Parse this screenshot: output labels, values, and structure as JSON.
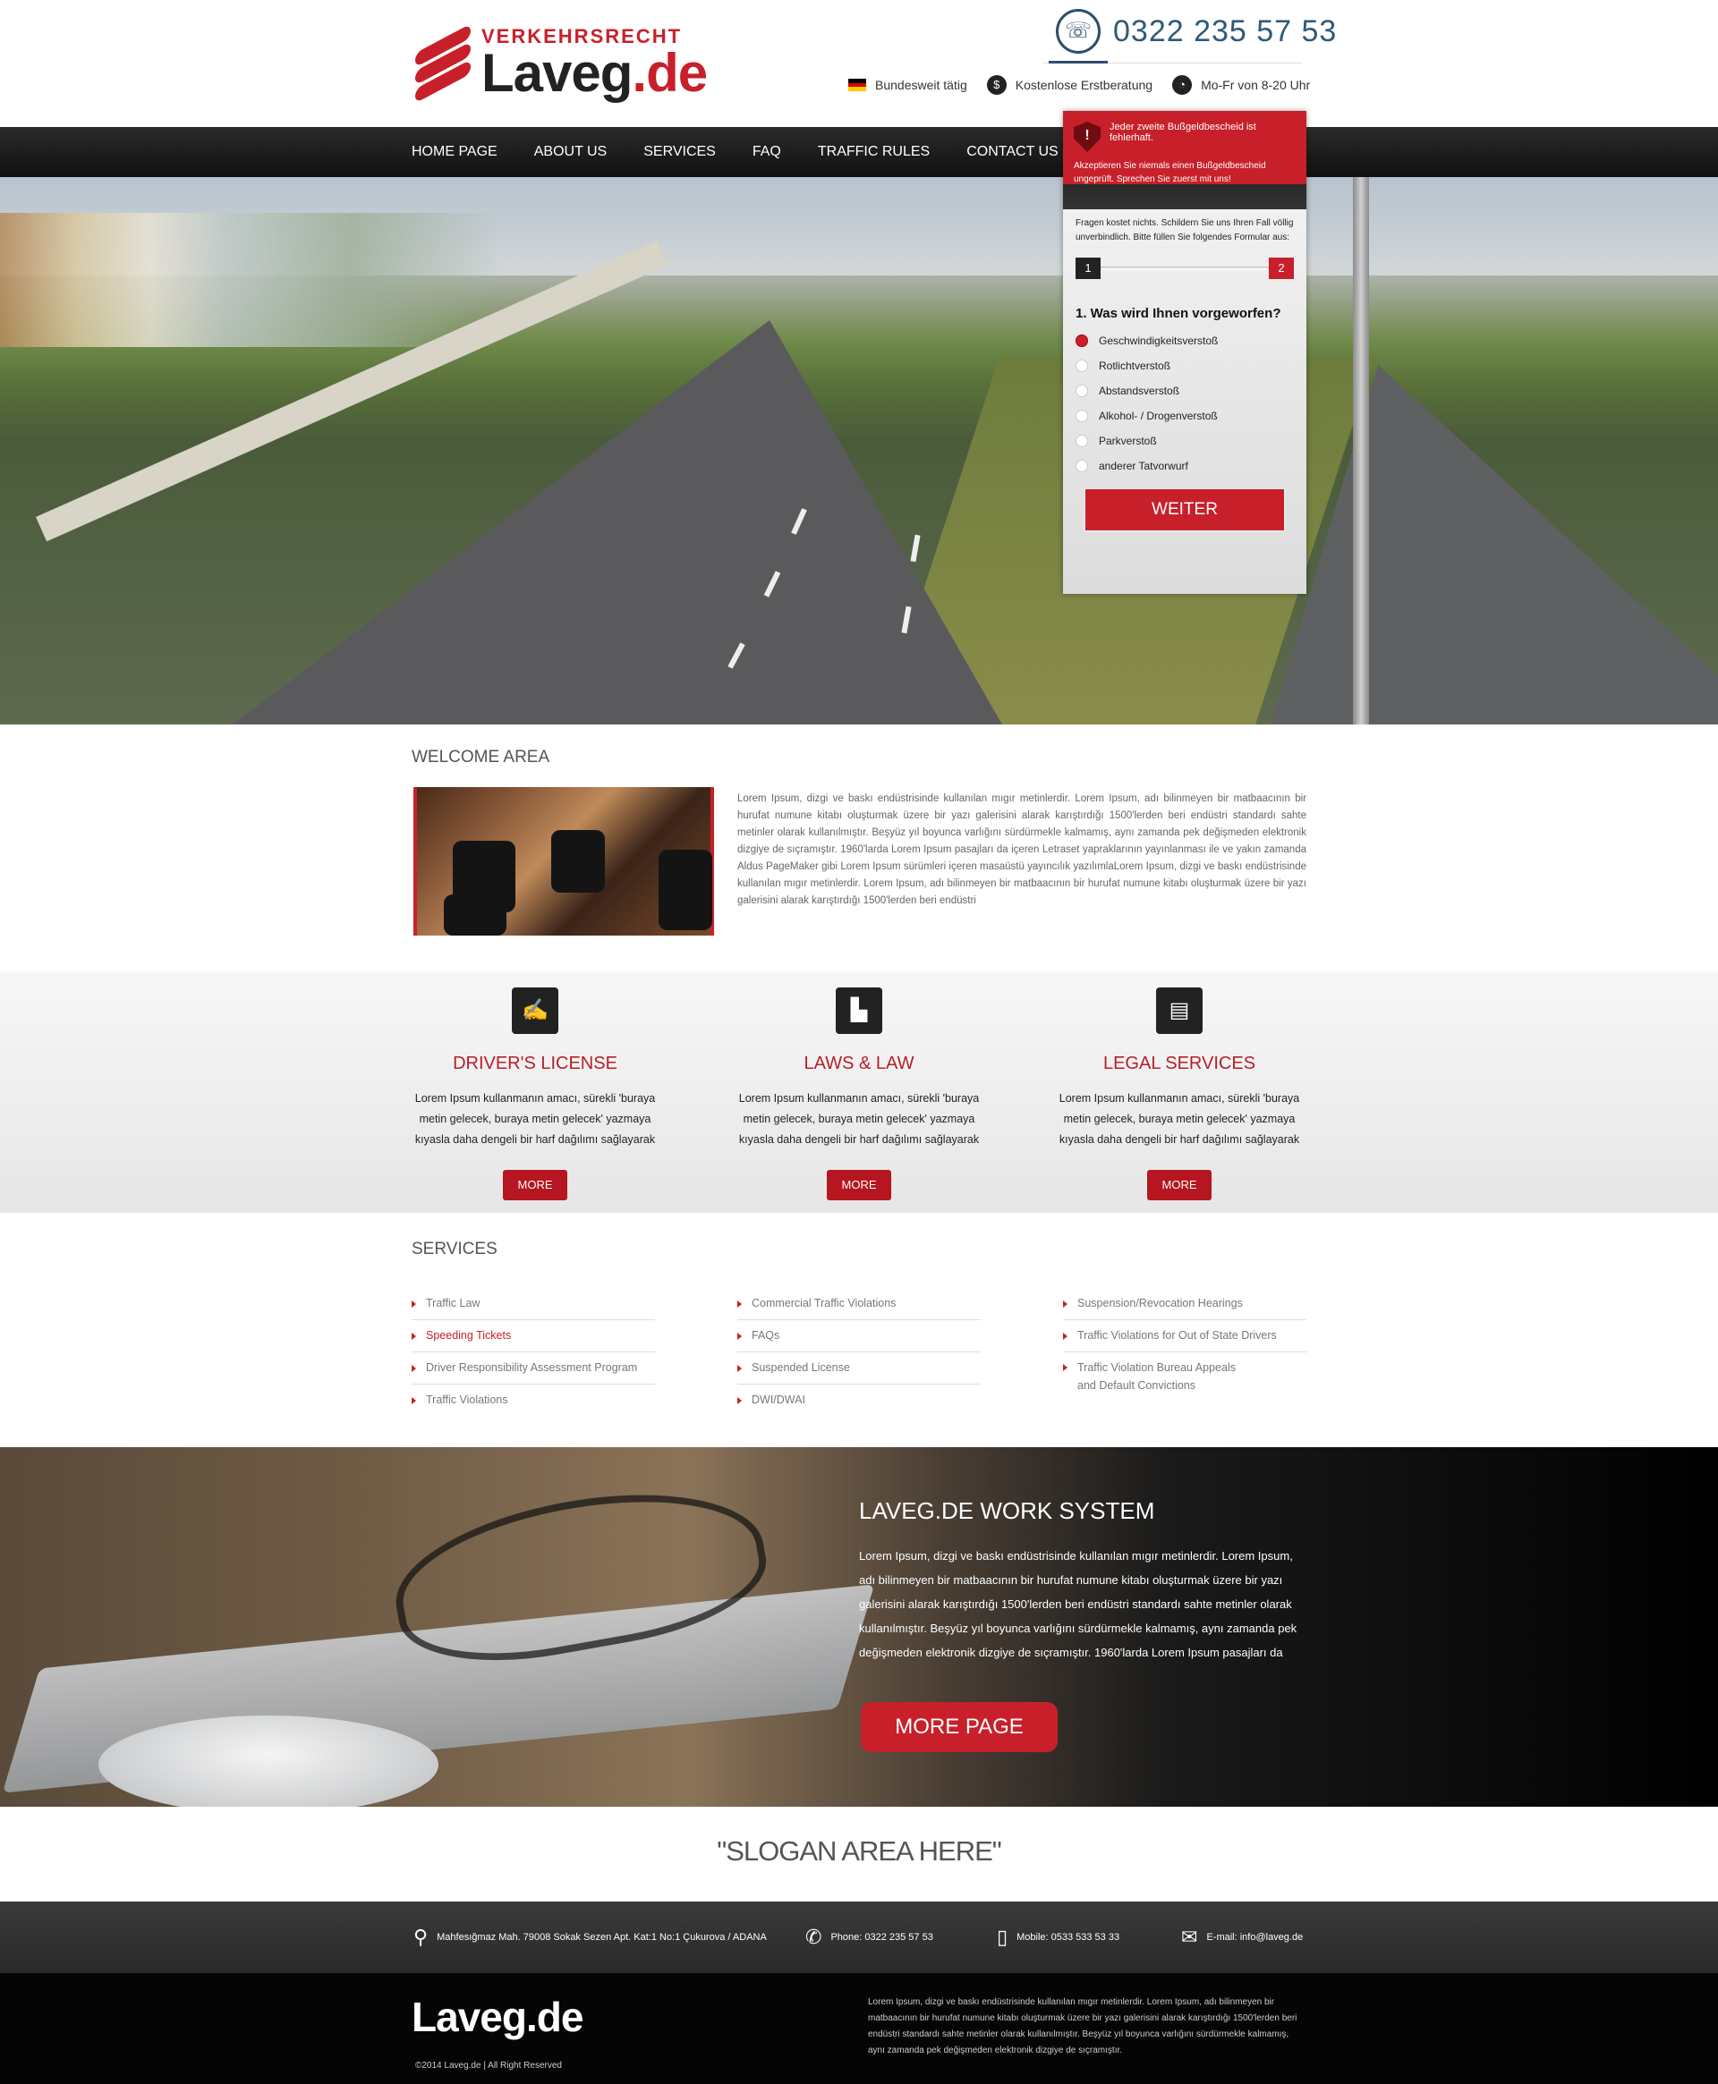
{
  "brand": {
    "kicker": "VERKEHRSRECHT",
    "name_main": "Laveg",
    "name_tld": ".de"
  },
  "header": {
    "phone": "0322 235 57 53",
    "info": [
      {
        "icon": "german-flag-icon",
        "label": "Bundesweit tätig"
      },
      {
        "icon": "money-icon",
        "label": "Kostenlose Erstberatung"
      },
      {
        "icon": "clock-icon",
        "label": "Mo-Fr von 8-20 Uhr"
      }
    ]
  },
  "nav": {
    "items": [
      "HOME PAGE",
      "ABOUT US",
      "SERVICES",
      "FAQ",
      "TRAFFIC RULES",
      "CONTACT US"
    ]
  },
  "form": {
    "warning_icon": "!",
    "warning_title": "Jeder zweite Bußgeldbescheid ist fehlerhaft.",
    "warning_sub": "Akzeptieren Sie niemals einen Bußgeldbescheid ungeprüft. Sprechen Sie zuerst mit uns!",
    "intro": "Fragen kostet nichts. Schildern Sie uns Ihren Fall völlig unverbindlich. Bitte füllen Sie folgendes Formular aus:",
    "step_current": "1",
    "step_next": "2",
    "question": "1. Was wird Ihnen vorgeworfen?",
    "options": [
      "Geschwindigkeitsverstoß",
      "Rotlichtverstoß",
      "Abstandsverstoß",
      "Alkohol- / Drogenverstoß",
      "Parkverstoß",
      "anderer Tatvorwurf"
    ],
    "selected_index": 0,
    "submit": "WEITER"
  },
  "welcome": {
    "title": "WELCOME AREA",
    "text": "Lorem Ipsum, dizgi ve baskı endüstrisinde kullanılan mıgır metinlerdir. Lorem Ipsum, adı bilinmeyen bir matbaacının bir hurufat numune kitabı oluşturmak üzere bir yazı galerisini alarak karıştırdığı 1500'lerden beri endüstri standardı sahte metinler olarak kullanılmıştır. Beşyüz yıl boyunca varlığını sürdürmekle kalmamış, aynı zamanda pek değişmeden elektronik dizgiye de sıçramıştır. 1960'larda Lorem Ipsum pasajları da içeren Letraset yapraklarının yayınlanması ile ve yakın zamanda Aldus PageMaker gibi Lorem Ipsum sürümleri içeren masaüstü yayıncılık yazılımlaLorem Ipsum, dizgi ve baskı endüstrisinde kullanılan mıgır metinlerdir. Lorem Ipsum, adı bilinmeyen bir matbaacının bir hurufat numune kitabı oluşturmak üzere bir yazı galerisini alarak karıştırdığı 1500'lerden beri endüstri"
  },
  "features": [
    {
      "icon": "license-icon",
      "glyph": "✍",
      "title": "DRIVER'S LICENSE",
      "text": "Lorem Ipsum kullanmanın amacı, sürekli 'buraya metin gelecek, buraya metin gelecek' yazmaya kıyasla daha dengeli bir harf dağılımı sağlayarak",
      "button": "MORE"
    },
    {
      "icon": "building-icon",
      "glyph": "▙",
      "title": "LAWS & LAW",
      "text": "Lorem Ipsum kullanmanın amacı, sürekli 'buraya metin gelecek, buraya metin gelecek' yazmaya kıyasla daha dengeli bir harf dağılımı sağlayarak",
      "button": "MORE"
    },
    {
      "icon": "briefcase-icon",
      "glyph": "▤",
      "title": "LEGAL SERVICES",
      "text": "Lorem Ipsum kullanmanın amacı, sürekli 'buraya metin gelecek, buraya metin gelecek' yazmaya kıyasla daha dengeli bir harf dağılımı sağlayarak",
      "button": "MORE"
    }
  ],
  "services": {
    "title": "SERVICES",
    "columns": [
      [
        "Traffic Law",
        "Speeding Tickets",
        "Driver Responsibility Assessment Program",
        "Traffic Violations"
      ],
      [
        "Commercial Traffic Violations",
        "FAQs",
        "Suspended License",
        "DWI/DWAI"
      ],
      [
        "Suspension/Revocation Hearings",
        "Traffic Violations for Out of State Drivers",
        "Traffic Violation Bureau Appeals and Default Convictions"
      ]
    ],
    "active": "Speeding Tickets"
  },
  "work": {
    "title": "LAVEG.DE WORK SYSTEM",
    "text": "Lorem Ipsum, dizgi ve baskı endüstrisinde kullanılan mıgır metinlerdir. Lorem Ipsum, adı bilinmeyen bir matbaacının bir hurufat numune kitabı oluşturmak üzere bir yazı galerisini alarak karıştırdığı 1500'lerden beri endüstri standardı sahte metinler olarak kullanılmıştır. Beşyüz yıl boyunca varlığını sürdürmekle kalmamış, aynı zamanda pek değişmeden elektronik dizgiye de sıçramıştır. 1960'larda Lorem Ipsum pasajları da",
    "button": "MORE PAGE"
  },
  "slogan": "\"SLOGAN AREA HERE\"",
  "contact": {
    "address": "Mahfesığmaz Mah. 79008 Sokak Sezen Apt. Kat:1 No:1 Çukurova / ADANA",
    "phone": "Phone: 0322 235 57 53",
    "mobile": "Mobile: 0533 533 53 33",
    "email": "E-mail: info@laveg.de"
  },
  "footer": {
    "logo": "Laveg.de",
    "copyright": "©2014 Laveg.de | All Right Reserved",
    "text": "Lorem Ipsum, dizgi ve baskı endüstrisinde kullanılan mıgır metinlerdir. Lorem Ipsum, adı bilinmeyen bir matbaacının bir hurufat numune kitabı oluşturmak üzere bir yazı galerisini alarak karıştırdığı 1500'lerden beri endüstri standardı sahte metinler olarak kullanılmıştır. Beşyüz yıl boyunca varlığını sürdürmekle kalmamış, aynı zamanda pek değişmeden elektronik dizgiye de sıçramıştır."
  },
  "colors": {
    "accent": "#c8202a",
    "nav": "#1a1a1a",
    "phone": "#2e5a78"
  }
}
